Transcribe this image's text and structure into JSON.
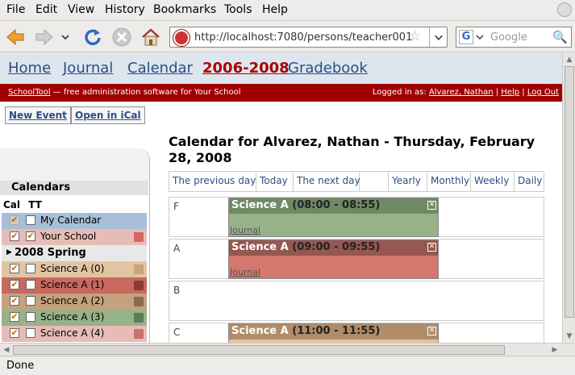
{
  "menu": {
    "file": "File",
    "edit": "Edit",
    "view": "View",
    "history": "History",
    "bookmarks": "Bookmarks",
    "tools": "Tools",
    "help": "Help"
  },
  "url": "http://localhost:7080/persons/teacher001",
  "search": {
    "placeholder": "Google"
  },
  "tabs": [
    "Home",
    "Journal",
    "Calendar",
    "2006-2008",
    "Gradebook"
  ],
  "redbar": {
    "brand": "SchoolTool",
    "tagline": " — free administration software for Your School",
    "logged_in_prefix": "Logged in as: ",
    "user": "Alvarez, Nathan",
    "help": "Help",
    "logout": "Log Out",
    "sep": " | "
  },
  "actions": {
    "new_event": "New Event",
    "open_ical": "Open in iCal"
  },
  "sidebar": {
    "title": "Calendars",
    "col_cal": "Cal",
    "col_tt": "TT",
    "items": [
      {
        "label": "My Calendar",
        "cal_checked": true,
        "cal_disabled": true,
        "tt_checked": false,
        "bg": "#a7bfd8",
        "swatch": ""
      },
      {
        "label": "Your School",
        "cal_checked": true,
        "tt_checked": true,
        "bg": "#e8bcb6",
        "swatch": "#d06a62"
      },
      {
        "term": "2008 Spring"
      },
      {
        "label": "Science A (0)",
        "cal_checked": true,
        "tt_checked": false,
        "bg": "#e2c4a2",
        "swatch": "#c9a37c"
      },
      {
        "label": "Science A (1)",
        "cal_checked": true,
        "tt_checked": false,
        "bg": "#c8685f",
        "swatch": "#8a3b34"
      },
      {
        "label": "Science A (2)",
        "cal_checked": true,
        "tt_checked": false,
        "bg": "#c4a27e",
        "swatch": "#8c6a4a"
      },
      {
        "label": "Science A (3)",
        "cal_checked": true,
        "tt_checked": false,
        "bg": "#97b288",
        "swatch": "#5e7d55"
      },
      {
        "label": "Science A (4)",
        "cal_checked": true,
        "tt_checked": false,
        "bg": "#e8bcb6",
        "swatch": "#c9736a"
      }
    ]
  },
  "calendar": {
    "title": "Calendar for Alvarez, Nathan - Thursday, February 28, 2008",
    "nav": [
      "The previous day",
      "Today",
      "The next day",
      "",
      "Yearly",
      "Monthly",
      "Weekly",
      "Daily"
    ],
    "rows": [
      {
        "label": "F",
        "event": {
          "title": "Science A",
          "time": "(08:00 - 08:55)",
          "link": "Journal",
          "head": "#6f8a62",
          "body": "#97b288"
        }
      },
      {
        "label": "A",
        "event": {
          "title": "Science A",
          "time": "(09:00 - 09:55)",
          "link": "Journal",
          "head": "#95574f",
          "body": "#d3776f"
        }
      },
      {
        "label": "B"
      },
      {
        "label": "C",
        "event": {
          "title": "Science A",
          "time": "(11:00 - 11:55)",
          "link": "",
          "head": "#b08c68",
          "body": "#e2c4a2"
        }
      }
    ]
  },
  "status": "Done"
}
